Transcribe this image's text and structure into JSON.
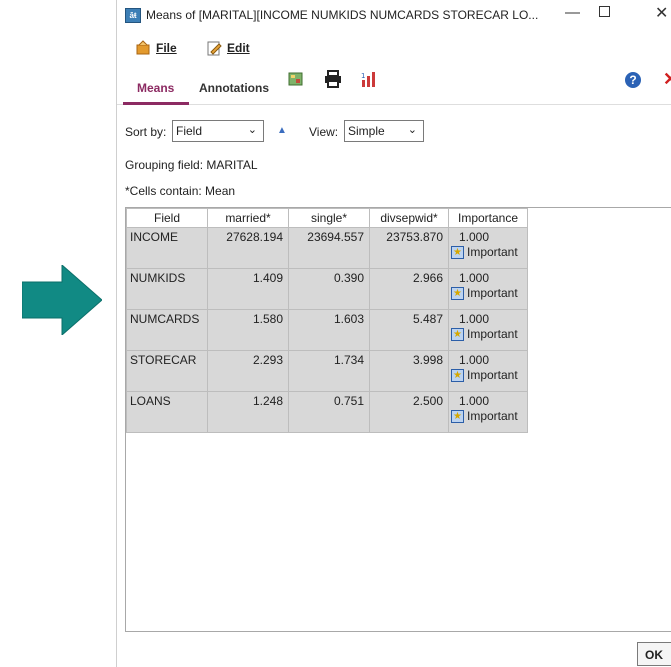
{
  "window": {
    "title": "Means of [MARITAL][INCOME NUMKIDS NUMCARDS STORECAR LO..."
  },
  "menu": {
    "file_label": "File",
    "edit_label": "Edit"
  },
  "tabs": [
    {
      "label": "Means",
      "active": true
    },
    {
      "label": "Annotations",
      "active": false
    }
  ],
  "controls": {
    "sort_by_label": "Sort by:",
    "sort_by_value": "Field",
    "view_label": "View:",
    "view_value": "Simple"
  },
  "info": {
    "grouping": "Grouping field: MARITAL",
    "cells": "*Cells contain: Mean"
  },
  "table": {
    "headers": [
      "Field",
      "married*",
      "single*",
      "divsepwid*",
      "Importance"
    ],
    "rows": [
      {
        "field": "INCOME",
        "married": "27628.194",
        "single": "23694.557",
        "divsepwid": "23753.870",
        "importance": "1.000",
        "flag": "Important"
      },
      {
        "field": "NUMKIDS",
        "married": "1.409",
        "single": "0.390",
        "divsepwid": "2.966",
        "importance": "1.000",
        "flag": "Important"
      },
      {
        "field": "NUMCARDS",
        "married": "1.580",
        "single": "1.603",
        "divsepwid": "5.487",
        "importance": "1.000",
        "flag": "Important"
      },
      {
        "field": "STORECAR",
        "married": "2.293",
        "single": "1.734",
        "divsepwid": "3.998",
        "importance": "1.000",
        "flag": "Important"
      },
      {
        "field": "LOANS",
        "married": "1.248",
        "single": "0.751",
        "divsepwid": "2.500",
        "importance": "1.000",
        "flag": "Important"
      }
    ]
  },
  "footer": {
    "ok_label": "OK"
  },
  "colors": {
    "arrow": "#118a84",
    "active_tab": "#8c2a62",
    "cell_bg": "#d8d8d8"
  }
}
